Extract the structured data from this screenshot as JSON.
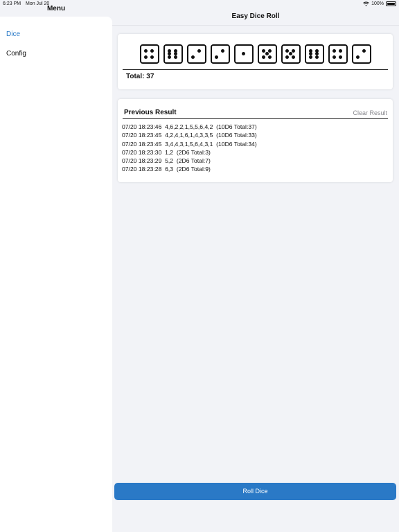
{
  "status_bar": {
    "time": "6:23 PM",
    "date": "Mon Jul 20",
    "battery": "100%"
  },
  "sidebar": {
    "title": "Menu",
    "items": [
      {
        "label": "Dice",
        "active": true
      },
      {
        "label": "Config",
        "active": false
      }
    ]
  },
  "header": {
    "title": "Easy Dice Roll"
  },
  "dice": {
    "values": [
      4,
      6,
      2,
      2,
      1,
      5,
      5,
      6,
      4,
      2
    ],
    "total_text": "Total: 37"
  },
  "history": {
    "title": "Previous Result",
    "clear_label": "Clear Result",
    "entries": [
      "07/20 18:23:46  4,6,2,2,1,5,5,6,4,2  (10D6 Total:37)",
      "07/20 18:23:45  4,2,4,1,6,1,4,3,3,5  (10D6 Total:33)",
      "07/20 18:23:45  3,4,4,3,1,5,6,4,3,1  (10D6 Total:34)",
      "07/20 18:23:30  1,2  (2D6 Total:3)",
      "07/20 18:23:29  5,2  (2D6 Total:7)",
      "07/20 18:23:28  6,3  (2D6 Total:9)"
    ]
  },
  "roll_button": {
    "label": "Roll Dice"
  },
  "colors": {
    "accent": "#2a79c6",
    "background": "#f2f3f7"
  },
  "icons": {
    "wifi": "wifi-icon",
    "battery": "battery-icon",
    "die_face": "die-icon"
  }
}
